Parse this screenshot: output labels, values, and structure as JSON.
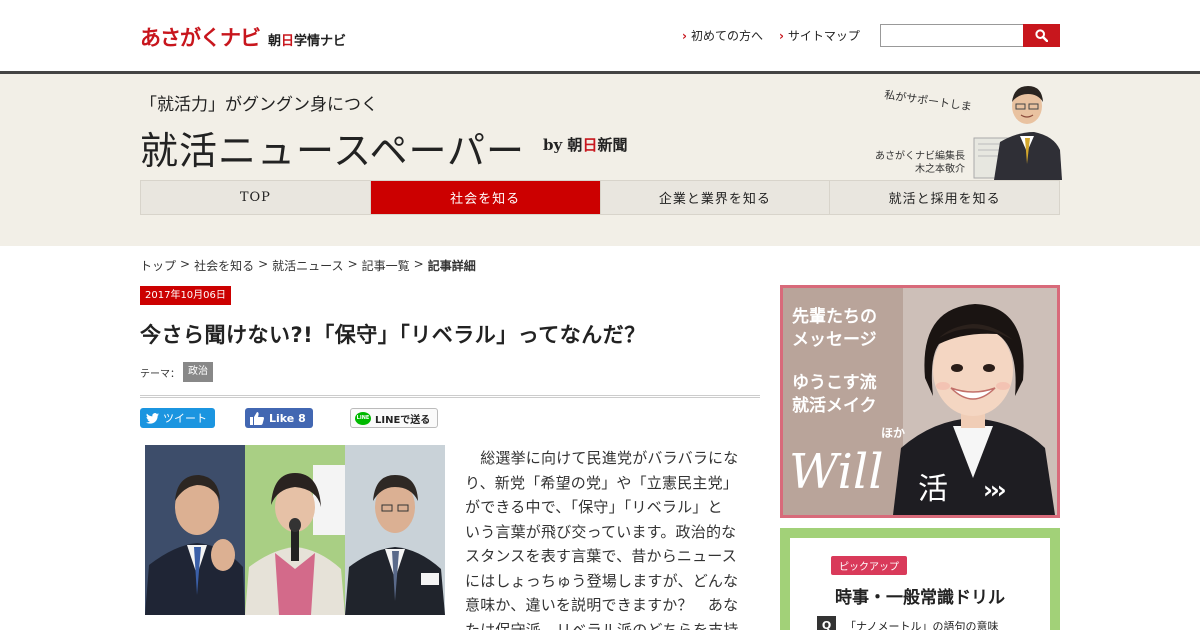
{
  "site": {
    "logo_main": "あさがくナビ",
    "logo_sub_pre": "朝",
    "logo_sub_red": "日",
    "logo_sub_post": "学情ナビ"
  },
  "toplinks": [
    {
      "label": "初めての方へ"
    },
    {
      "label": "サイトマップ"
    }
  ],
  "search": {
    "placeholder": "",
    "button_icon": "search-icon"
  },
  "header": {
    "tagline": "「就活力」がグングン身につく",
    "title": "就活ニュースペーパー",
    "byline_pre": "by 朝",
    "byline_red": "日",
    "byline_post": "新聞",
    "editor_handwrite": "私がサポートします！",
    "editor_caption_1": "あさがくナビ編集長",
    "editor_caption_2": "木之本敬介"
  },
  "nav": [
    {
      "label": "TOP",
      "active": false
    },
    {
      "label": "社会を知る",
      "active": true
    },
    {
      "label": "企業と業界を知る",
      "active": false
    },
    {
      "label": "就活と採用を知る",
      "active": false
    }
  ],
  "breadcrumb": {
    "items": [
      "トップ",
      "社会を知る",
      "就活ニュース",
      "記事一覧"
    ],
    "separator": ">",
    "current": "記事詳細"
  },
  "article": {
    "date": "2017年10月06日",
    "headline": "今さら聞けない?!「保守」「リベラル」ってなんだ？",
    "theme_label": "テーマ：",
    "theme_tag": "政治",
    "share": {
      "tweet": "ツイート",
      "like": "Like 8",
      "line_badge": "LINE",
      "line": "LINEで送る"
    },
    "body_lines": [
      "　総選挙に向けて民進党がバラバラにな",
      "り、新党「希望の党」や「立憲民主党」",
      "ができる中で、「保守」「リベラル」と",
      "いう言葉が飛び交っています。政治的な",
      "スタンスを表す言葉で、昔からニュース",
      "にはしょっちゅう登場しますが、どんな",
      "意味か、違いを説明できますか？　あな",
      "たは保守派、リベラル派のどちらを支持"
    ]
  },
  "sidebar": {
    "promo": {
      "line1": "先輩たちの",
      "line2": "メッセージ",
      "line3": "ゆうこす流",
      "line4": "就活メイク",
      "hoka": "ほか",
      "will": "Will",
      "katsu": "活",
      "arrows": "›››"
    },
    "drill": {
      "pickup": "ピックアップ",
      "title": "時事・一般常識ドリル",
      "q_mark": "Q",
      "question": "「ナノメートル」の語句の意味"
    }
  },
  "colors": {
    "brand_red": "#c8161d",
    "nav_active": "#cc0000",
    "band_bg": "#f2efe7",
    "twitter_blue": "#1b95e0",
    "facebook_blue": "#4267b2",
    "line_green": "#00b900",
    "drill_green": "#a2d178"
  }
}
